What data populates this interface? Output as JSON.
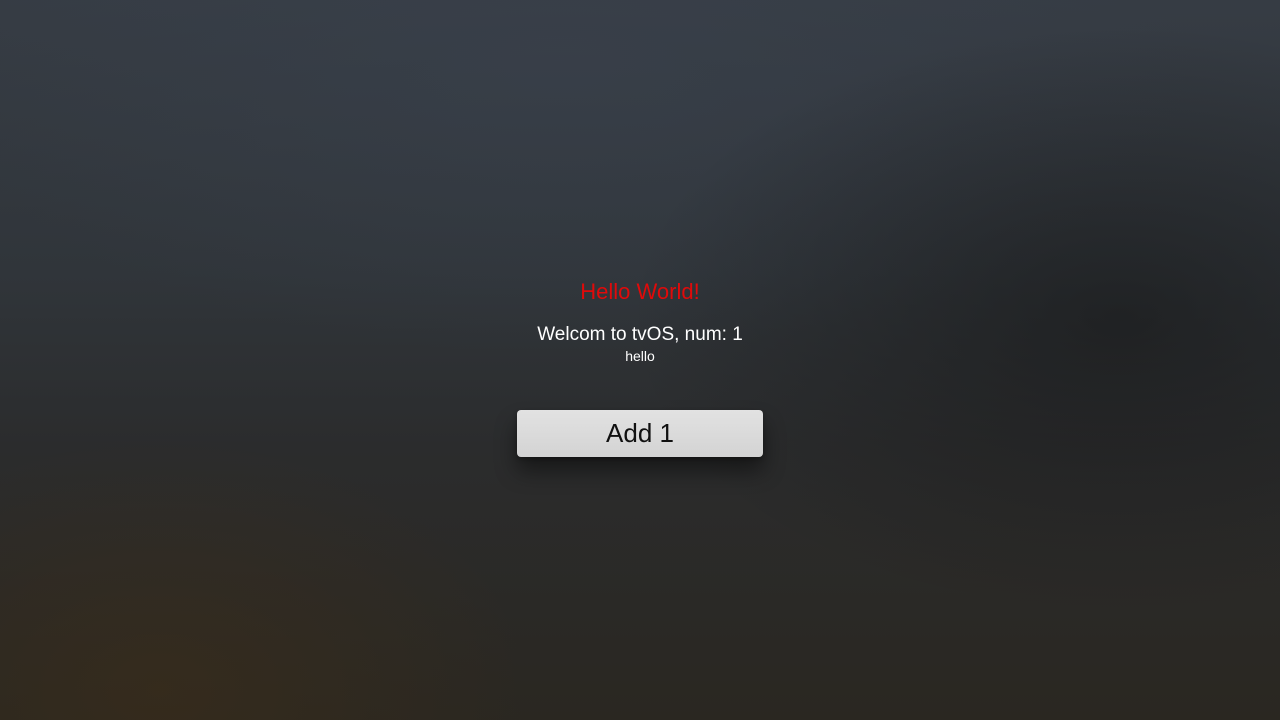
{
  "screen": {
    "title": "Hello World!",
    "welcome_text": "Welcom to tvOS, num: 1",
    "subtitle": "hello",
    "add_button_label": "Add 1"
  },
  "colors": {
    "title": "#e00a0a",
    "text": "#ffffff",
    "button_background": "#d8d8d8",
    "button_text": "#111111"
  }
}
